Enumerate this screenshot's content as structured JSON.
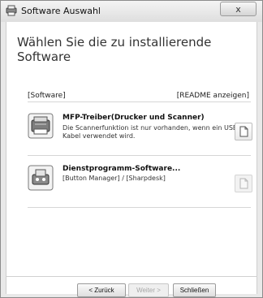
{
  "window": {
    "title": "Software Auswahl",
    "close_label": "x"
  },
  "heading": "Wählen Sie die zu installierende Software",
  "columns": {
    "left": "[Software]",
    "right": "[README anzeigen]"
  },
  "items": [
    {
      "title": "MFP-Treiber(Drucker und Scanner)",
      "description": "Die Scannerfunktion ist nur vorhanden, wenn ein USB-Kabel verwendet wird.",
      "readme_enabled": true,
      "icon": "printer-scanner-icon"
    },
    {
      "title": "Dienstprogramm-Software...",
      "description": "[Button Manager] / [Sharpdesk]",
      "readme_enabled": false,
      "icon": "utility-software-icon"
    }
  ],
  "footer": {
    "back_label": "< Zurück",
    "next_label": "Weiter >",
    "close_label": "Schließen"
  }
}
